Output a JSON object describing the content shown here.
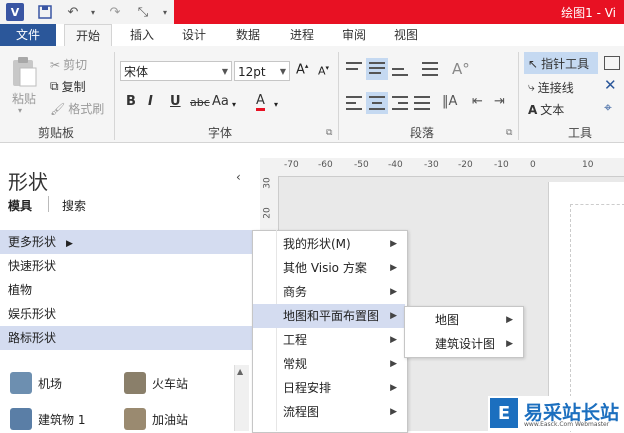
{
  "title_bar": {
    "doc_title": "绘图1 - Vi"
  },
  "tabs": [
    "文件",
    "开始",
    "插入",
    "设计",
    "数据",
    "进程",
    "审阅",
    "视图"
  ],
  "ribbon": {
    "clipboard": {
      "paste": "粘贴",
      "cut": "剪切",
      "copy": "复制",
      "format_painter": "格式刷",
      "label": "剪贴板"
    },
    "font": {
      "name": "宋体",
      "size": "12pt",
      "label": "字体",
      "bold": "B",
      "italic": "I",
      "underline": "U",
      "strike": "abc",
      "case": "Aa",
      "color": "A"
    },
    "paragraph": {
      "label": "段落"
    },
    "tools": {
      "pointer": "指针工具",
      "connector": "连接线",
      "text": "文本",
      "label": "工具"
    }
  },
  "shapes_pane": {
    "title": "形状",
    "tab_stencils": "模具",
    "tab_search": "搜索",
    "items": [
      "更多形状",
      "快速形状",
      "植物",
      "娱乐形状",
      "路标形状"
    ],
    "stencils": [
      "机场",
      "火车站",
      "建筑物 1",
      "加油站"
    ]
  },
  "ruler": {
    "h_ticks": [
      "-70",
      "-60",
      "-50",
      "-40",
      "-30",
      "-20",
      "-10",
      "0",
      "10"
    ],
    "v_ticks": [
      "30",
      "20"
    ]
  },
  "menu_main": [
    {
      "label": "我的形状(M)",
      "underline_key": "M"
    },
    {
      "label": "其他 Visio 方案"
    },
    {
      "label": "商务"
    },
    {
      "label": "地图和平面布置图"
    },
    {
      "label": "工程"
    },
    {
      "label": "常规"
    },
    {
      "label": "日程安排"
    },
    {
      "label": "流程图"
    }
  ],
  "menu_sub": [
    "地图",
    "建筑设计图"
  ],
  "watermark": {
    "text": "易采站长站",
    "sub": "www.Easck.Com  Webmaster"
  },
  "colors": {
    "accent": "#2b579a",
    "titlebar_red": "#e81123",
    "selected": "#d4dcf0"
  }
}
